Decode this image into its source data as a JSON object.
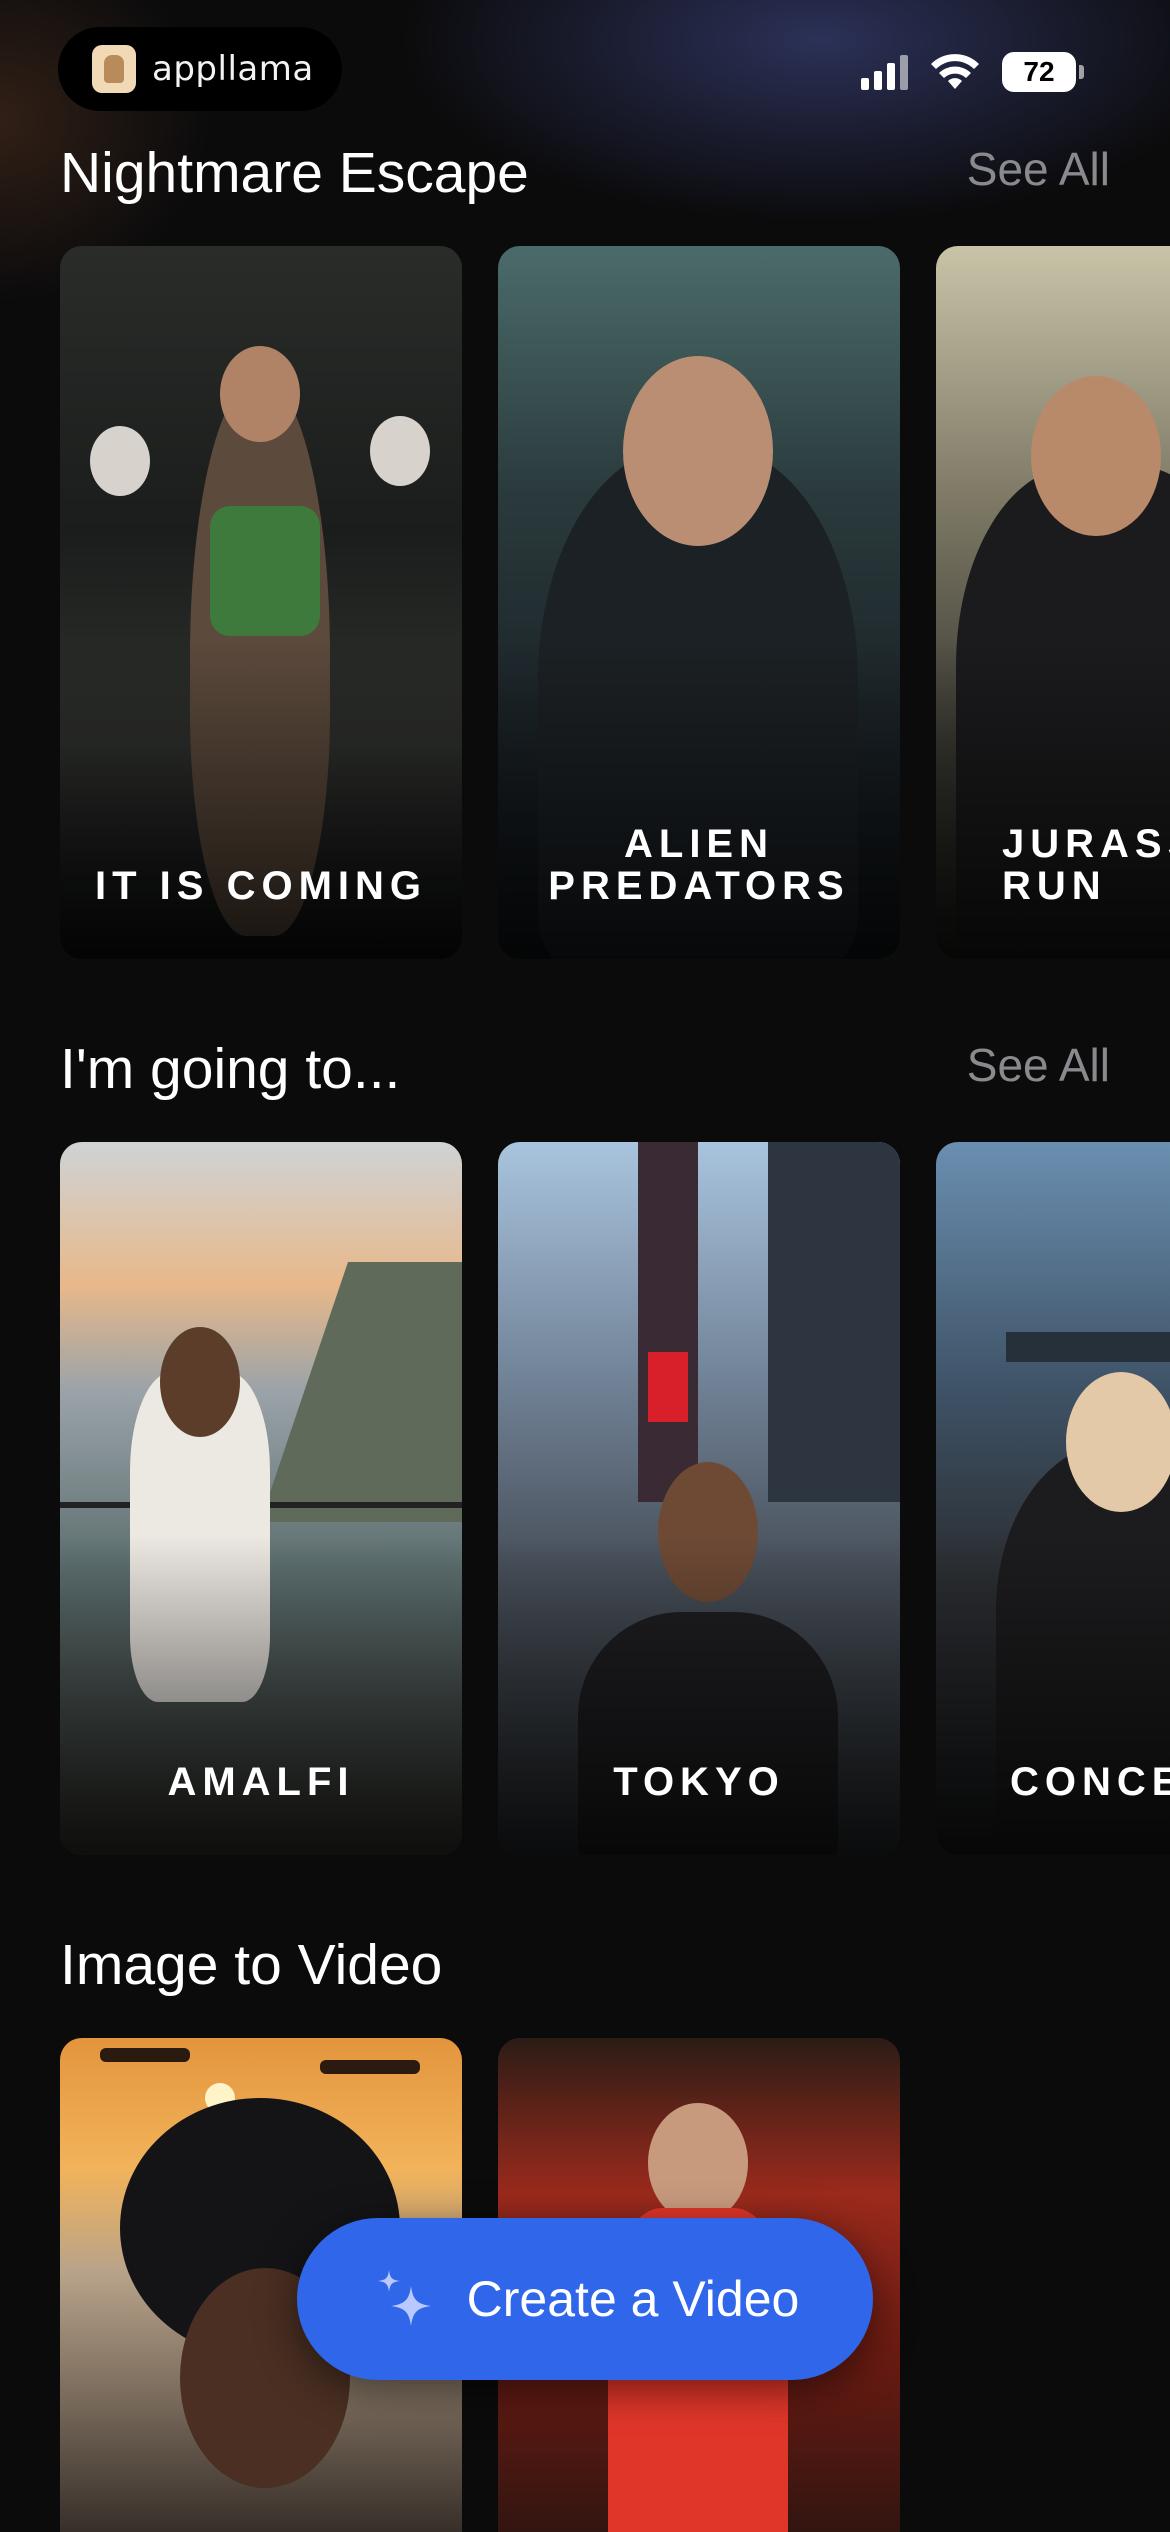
{
  "status_bar": {
    "brand": "appllama",
    "battery": "72"
  },
  "sections": [
    {
      "title": "Nightmare Escape",
      "see_all": "See All",
      "cards": [
        {
          "label": "IT IS COMING"
        },
        {
          "label": "ALIEN\nPREDATORS"
        },
        {
          "label": "JURASSIC\nRUN"
        }
      ]
    },
    {
      "title": "I'm going to...",
      "see_all": "See All",
      "cards": [
        {
          "label": "AMALFI"
        },
        {
          "label": "TOKYO"
        },
        {
          "label": "CONCERT"
        }
      ]
    },
    {
      "title": "Image to Video",
      "cards": [
        {
          "label": ""
        },
        {
          "label": ""
        }
      ]
    }
  ],
  "cta": {
    "label": "Create a Video",
    "icon": "sparkles-icon"
  }
}
